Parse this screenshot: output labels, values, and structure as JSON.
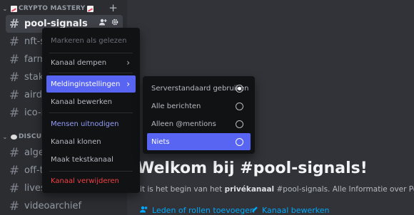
{
  "sidebar": {
    "category1": {
      "label": "CRYPTO MASTERY",
      "add_icon": "plus-icon"
    },
    "category2": {
      "label": "DISCUSS"
    },
    "channels": [
      {
        "name": "pool-signals",
        "active": true
      },
      {
        "name": "nft-si"
      },
      {
        "name": "farm-"
      },
      {
        "name": "stakin"
      },
      {
        "name": "airdro"
      },
      {
        "name": "ico-id"
      },
      {
        "name": "algem"
      },
      {
        "name": "off-to"
      },
      {
        "name": "livest"
      },
      {
        "name": "videoarchief"
      }
    ]
  },
  "context_menu": {
    "mark_read": "Markeren als gelezen",
    "mute": "Kanaal dempen",
    "notifications": "Meldinginstellingen",
    "edit": "Kanaal bewerken",
    "invite": "Mensen uitnodigen",
    "clone": "Kanaal klonen",
    "text_channel": "Maak tekstkanaal",
    "delete": "Kanaal verwijderen"
  },
  "notification_submenu": {
    "options": [
      {
        "label": "Serverstandaard gebruiken",
        "selected": true
      },
      {
        "label": "Alle berichten",
        "selected": false
      },
      {
        "label": "Alleen @mentions",
        "selected": false
      },
      {
        "label": "Niets",
        "selected": false,
        "highlighted": true
      }
    ]
  },
  "main": {
    "heading": "Welkom bij #pool-signals!",
    "subtitle_start": "it is het begin van het ",
    "subtitle_bold": "privékanaal",
    "subtitle_end": " #pool-signals. Alle Informatie over Pools",
    "link_members": "Leden of rollen toevoegen",
    "link_edit": "Kanaal bewerken"
  },
  "colors": {
    "accent": "#5865f2",
    "danger": "#f23f43",
    "link": "#00a8fc"
  }
}
